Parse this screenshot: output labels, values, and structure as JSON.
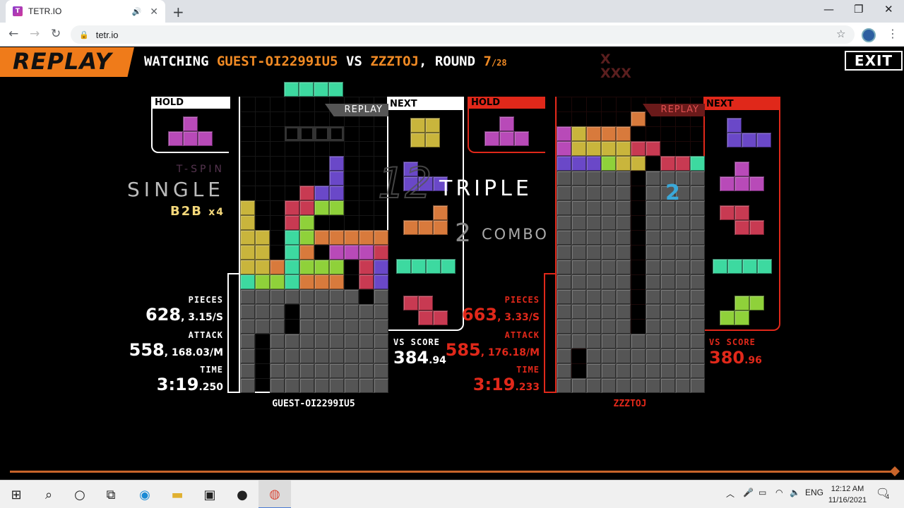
{
  "browser": {
    "tab_title": "TETR.IO",
    "tab_favicon_text": "T",
    "address": "tetr.io",
    "new_tab": "+"
  },
  "header": {
    "replay_label": "REPLAY",
    "watching_prefix": "WATCHING ",
    "player1": "GUEST-OI2299IU5",
    "vs_text": " VS ",
    "player2": "ZZZTOJ",
    "round_prefix": ", ROUND ",
    "round_current": "7",
    "round_total": "/28",
    "exit_label": "EXIT",
    "x_marks_top": "X",
    "x_marks_bottom": "XXX"
  },
  "left_player": {
    "hold_label": "HOLD",
    "next_label": "NEXT",
    "replay_ribbon": "REPLAY",
    "tspin_text": "T-SPIN",
    "clear_text": "SINGLE",
    "b2b_text": "B2B",
    "b2b_count": "x4",
    "pieces_label": "PIECES",
    "pieces_value": "628",
    "pieces_rate": ", 3.15/S",
    "attack_label": "ATTACK",
    "attack_value": "558",
    "attack_rate": ", 168.03/M",
    "time_label": "TIME",
    "time_value": "3:19",
    "time_ms": ".250",
    "vs_score_label": "VS SCORE",
    "vs_score_value": "384",
    "vs_score_dec": ".94",
    "name": "GUEST-OI2299IU5"
  },
  "right_player": {
    "hold_label": "HOLD",
    "next_label": "NEXT",
    "replay_ribbon": "REPLAY",
    "clear_text": "TRIPLE",
    "combo_number": "2",
    "combo_text": "COMBO",
    "spin_number": "12",
    "board_number": "2",
    "pieces_label": "PIECES",
    "pieces_value": "663",
    "pieces_rate": ", 3.33/S",
    "attack_label": "ATTACK",
    "attack_value": "585",
    "attack_rate": ", 176.18/M",
    "time_label": "TIME",
    "time_value": "3:19",
    "time_ms": ".233",
    "vs_score_label": "VS SCORE",
    "vs_score_value": "380",
    "vs_score_dec": ".96",
    "name": "ZZZTOJ"
  },
  "colors": {
    "accent_orange": "#ef7b1a",
    "red_player": "#e0281a",
    "T": "#b84ab8",
    "O": "#c9b53c",
    "I": "#3dd9a0",
    "L": "#d87a3c",
    "J": "#6a48c8",
    "S": "#8fd13a",
    "Z": "#c83a52",
    "garbage": "#555555"
  },
  "replay_progress": 1.0,
  "taskbar": {
    "lang": "ENG",
    "time": "12:12 AM",
    "date": "11/16/2021",
    "notifications": "4"
  }
}
